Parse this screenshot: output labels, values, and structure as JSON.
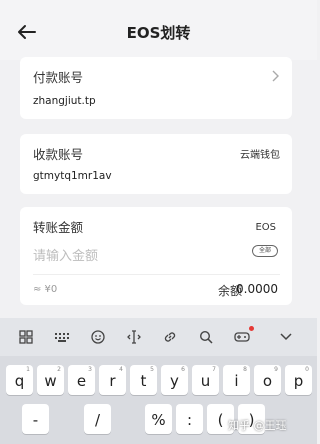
{
  "header": {
    "title": "EOS划转"
  },
  "pay_account": {
    "label": "付款账号",
    "value": "zhangjiut.tp"
  },
  "receive_account": {
    "label": "收款账号",
    "value": "gtmytq1mr1av",
    "wallet_link": "云端钱包"
  },
  "amount": {
    "label": "转账金额",
    "token": "EOS",
    "placeholder": "请输入金额",
    "all_button": "全部",
    "approx": "≈ ¥0",
    "balance_label": "余额",
    "balance_value": "0.0000"
  },
  "keyboard": {
    "toolbar_icons": [
      "grid-icon",
      "keyboard-icon",
      "emoji-icon",
      "cursor-icon",
      "link-icon",
      "search-icon",
      "gamepad-icon",
      "chevron-down-icon"
    ],
    "row1": [
      {
        "ch": "q",
        "num": "1"
      },
      {
        "ch": "w",
        "num": "2"
      },
      {
        "ch": "e",
        "num": "3"
      },
      {
        "ch": "r",
        "num": "4"
      },
      {
        "ch": "t",
        "num": "5"
      },
      {
        "ch": "y",
        "num": "6"
      },
      {
        "ch": "u",
        "num": "7"
      },
      {
        "ch": "i",
        "num": "8"
      },
      {
        "ch": "o",
        "num": "9"
      },
      {
        "ch": "p",
        "num": "0"
      }
    ],
    "row2": [
      {
        "ch": "-",
        "num": ""
      },
      {
        "ch": "/",
        "num": ""
      },
      {
        "ch": "%",
        "num": ""
      },
      {
        "ch": ":",
        "num": ""
      },
      {
        "ch": "(",
        "num": ""
      },
      {
        "ch": ")",
        "num": ""
      }
    ]
  },
  "watermark": "知乎 @王珏"
}
